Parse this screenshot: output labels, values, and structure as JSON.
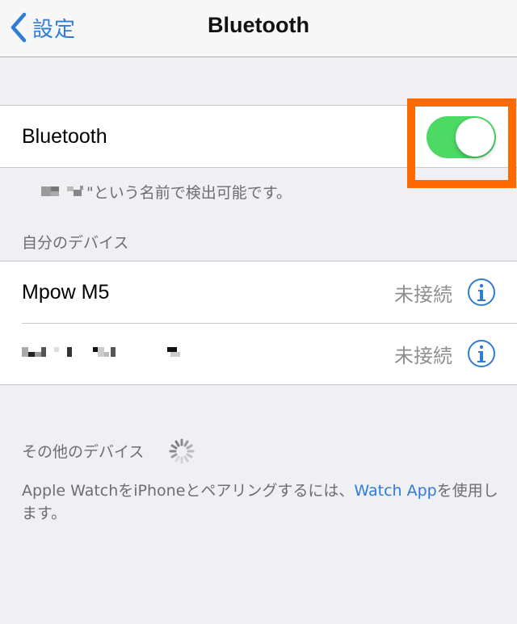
{
  "navbar": {
    "back_label": "設定",
    "title": "Bluetooth"
  },
  "bluetooth": {
    "label": "Bluetooth",
    "enabled": true,
    "toggle_color": "#4cd964",
    "highlight_color": "#ff6a00"
  },
  "discoverable_text": "\"という名前で検出可能です。",
  "my_devices": {
    "header": "自分のデバイス",
    "items": [
      {
        "name": "Mpow M5",
        "status": "未接続"
      },
      {
        "name": "",
        "status": "未接続"
      }
    ]
  },
  "other_devices": {
    "header": "その他のデバイス"
  },
  "watch_note": {
    "before": "Apple WatchをiPhoneとペアリングするには、",
    "link": "Watch App",
    "after": "を使用します。"
  },
  "colors": {
    "accent": "#2e7cd6",
    "background": "#efeff4",
    "secondary_text": "#6d6d72"
  }
}
